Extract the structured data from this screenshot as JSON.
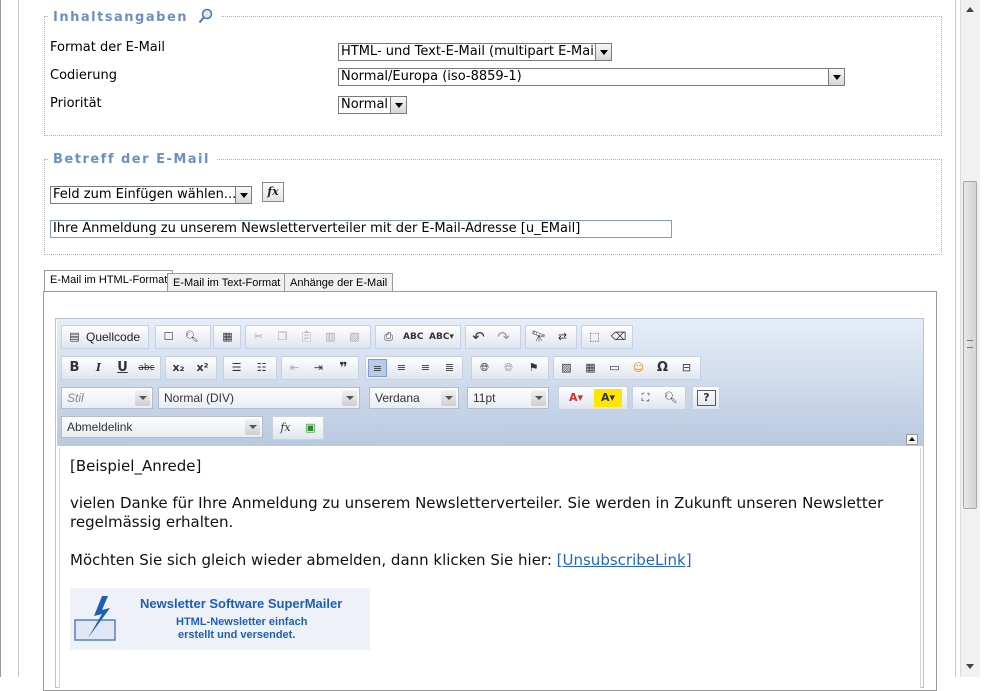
{
  "content_section": {
    "legend": "Inhaltsangaben",
    "format_label": "Format der E-Mail",
    "format_value": "HTML- und Text-E-Mail (multipart E-Mail)",
    "encoding_label": "Codierung",
    "encoding_value": "Normal/Europa (iso-8859-1)",
    "priority_label": "Priorität",
    "priority_value": "Normal"
  },
  "subject_section": {
    "legend": "Betreff der E-Mail",
    "insert_field_value": "Feld zum Einfügen wählen...",
    "fx_label": "fx",
    "subject_value": "Ihre Anmeldung zu unserem Newsletterverteiler mit der E-Mail-Adresse [u_EMail]"
  },
  "tabs": [
    {
      "label": "E-Mail im HTML-Format",
      "active": true
    },
    {
      "label": "E-Mail im Text-Format",
      "active": false
    },
    {
      "label": "Anhänge der E-Mail",
      "active": false
    }
  ],
  "editor_toolbar": {
    "source_label": "Quellcode",
    "style_combo": "Stil",
    "format_combo": "Normal (DIV)",
    "font_combo": "Verdana",
    "size_combo": "11pt",
    "placeholder_combo": "Abmeldelink",
    "bold": "B",
    "italic": "I",
    "underline": "U",
    "strike": "abc",
    "subscript": "x₂",
    "superscript": "x²",
    "special_char": "Ω",
    "help": "?",
    "fx_label": "fx"
  },
  "editor_content": {
    "greeting": "[Beispiel_Anrede]",
    "paragraph1_line1": "vielen Danke für Ihre Anmeldung zu unserem Newsletterverteiler. Sie werden in Zukunft unseren Newsletter",
    "paragraph1_line2": "regelmässig erhalten.",
    "paragraph2_text": "Möchten Sie sich gleich wieder abmelden, dann klicken Sie hier: ",
    "unsubscribe_link": "[UnsubscribeLink]",
    "banner_title": "Newsletter Software SuperMailer",
    "banner_line1": "HTML-Newsletter einfach",
    "banner_line2": "erstellt und versendet."
  },
  "colors": {
    "legend": "#6b8fc7",
    "toolbar_top": "#e6edf7",
    "toolbar_bottom": "#b9c9e0",
    "link": "#2266cc",
    "banner_title": "#1e5fb4"
  }
}
